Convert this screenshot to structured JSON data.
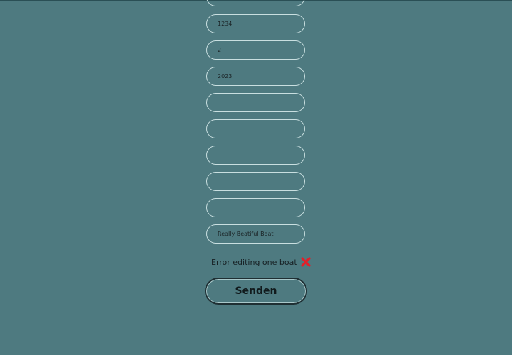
{
  "form": {
    "fields": [
      {
        "value": "",
        "placeholder": ""
      },
      {
        "value": "1234",
        "placeholder": ""
      },
      {
        "value": "2",
        "placeholder": ""
      },
      {
        "value": "2023",
        "placeholder": ""
      },
      {
        "value": "",
        "placeholder": ""
      },
      {
        "value": "",
        "placeholder": ""
      },
      {
        "value": "",
        "placeholder": ""
      },
      {
        "value": "",
        "placeholder": ""
      },
      {
        "value": "",
        "placeholder": ""
      },
      {
        "value": "Really Beatiful Boat",
        "placeholder": ""
      }
    ],
    "status_message": "Error editing one boat",
    "status_icon": "cross-mark-icon",
    "submit_label": "Senden"
  },
  "colors": {
    "background": "#4e7a80",
    "field_border": "#c9dfe0",
    "error_icon": "#e0202a"
  }
}
